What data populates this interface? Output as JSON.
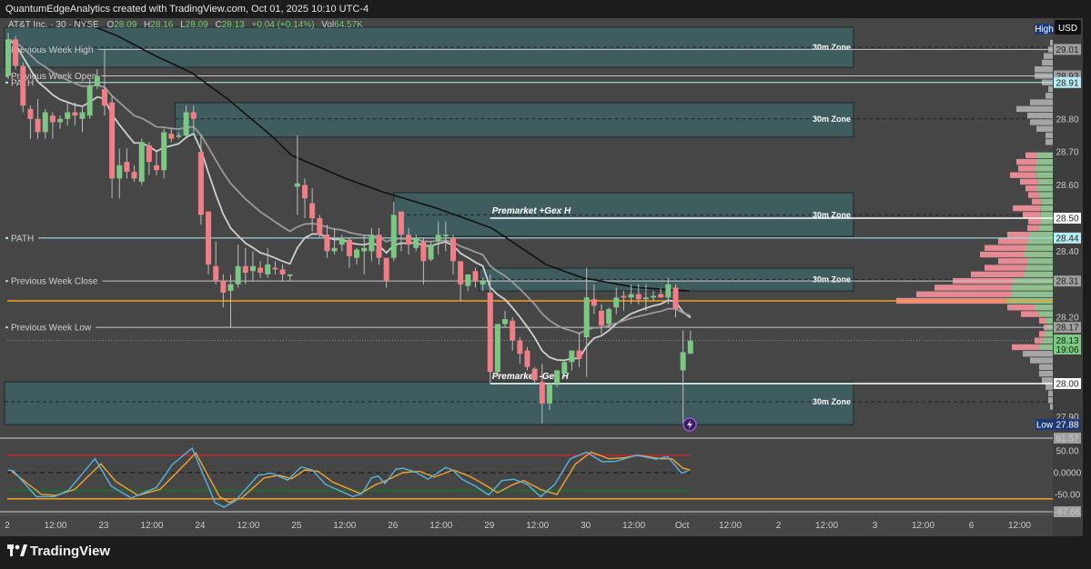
{
  "header": {
    "title": "QuantumEdgeAnalytics created with TradingView.com, Oct 01, 2025 10:10 UTC-4"
  },
  "legend": {
    "symbol": "AT&T Inc. · 30 · NYSE",
    "o_label": "O",
    "o": "28.09",
    "h_label": "H",
    "h": "28.16",
    "l_label": "L",
    "l": "28.09",
    "c_label": "C",
    "c": "28.13",
    "change": "+0.04 (+0.14%)",
    "vol_label": "Vol",
    "vol": "64.57K"
  },
  "axis": {
    "currency": "USD",
    "high_tag": "High",
    "high_value": "29.01",
    "low_tag": "Low",
    "low_value": "27.88",
    "countdown": "19:06"
  },
  "footer": {
    "brand": "TradingView"
  },
  "colors": {
    "up": "#7cc784",
    "down": "#ef7e86",
    "background": "#464646",
    "zone_fill": "#3f5c5e",
    "path": "#b6eef6",
    "orange": "#f5a023",
    "sma": "#111111",
    "ema_fast": "#cfcfcf",
    "ema_slow": "#9a9a9a",
    "osc_k": "#56b4e0",
    "osc_d": "#f2a431"
  },
  "chart_data": {
    "type": "candlestick",
    "title": "AT&T Inc. · 30 · NYSE",
    "interval": "30m",
    "ylim": [
      27.85,
      29.1
    ],
    "price_ticks": [
      "28.80",
      "28.70",
      "28.60",
      "28.40",
      "28.20",
      "27.90"
    ],
    "time_labels": [
      "2",
      "12:00",
      "23",
      "12:00",
      "24",
      "12:00",
      "25",
      "12:00",
      "26",
      "12:00",
      "29",
      "12:00",
      "30",
      "12:00",
      "Oct",
      "12:00",
      "2",
      "12:00",
      "3",
      "12:00",
      "6",
      "12:00"
    ],
    "time_label_bars": [
      0,
      6.5,
      13,
      19.5,
      26,
      32.5,
      39,
      45.5,
      52,
      58.5,
      65,
      71.5,
      78,
      84.5,
      91,
      97.5,
      104,
      110.5,
      117,
      123.5,
      130,
      136.5
    ],
    "candles_ohlc": [
      [
        28.93,
        29.06,
        28.92,
        29.04
      ],
      [
        29.04,
        29.05,
        28.95,
        28.96
      ],
      [
        28.96,
        28.97,
        28.82,
        28.84
      ],
      [
        28.83,
        28.84,
        28.74,
        28.8
      ],
      [
        28.8,
        28.86,
        28.74,
        28.76
      ],
      [
        28.76,
        28.83,
        28.74,
        28.82
      ],
      [
        28.81,
        28.82,
        28.74,
        28.79
      ],
      [
        28.79,
        28.81,
        28.77,
        28.8
      ],
      [
        28.8,
        28.85,
        28.78,
        28.82
      ],
      [
        28.82,
        28.85,
        28.78,
        28.81
      ],
      [
        28.8,
        28.84,
        28.76,
        28.82
      ],
      [
        28.81,
        28.92,
        28.8,
        28.9
      ],
      [
        28.9,
        28.95,
        28.89,
        28.93
      ],
      [
        28.89,
        29.01,
        28.81,
        28.84
      ],
      [
        28.85,
        28.87,
        28.56,
        28.62
      ],
      [
        28.62,
        28.71,
        28.56,
        28.66
      ],
      [
        28.67,
        28.71,
        28.62,
        28.64
      ],
      [
        28.64,
        28.66,
        28.61,
        28.62
      ],
      [
        28.61,
        28.74,
        28.6,
        28.73
      ],
      [
        28.72,
        28.73,
        28.63,
        28.67
      ],
      [
        28.66,
        28.7,
        28.63,
        28.645
      ],
      [
        28.645,
        28.77,
        28.62,
        28.76
      ],
      [
        28.755,
        28.77,
        28.73,
        28.74
      ],
      [
        28.745,
        28.76,
        28.74,
        28.75
      ],
      [
        28.75,
        28.84,
        28.74,
        28.82
      ],
      [
        28.82,
        28.84,
        28.76,
        28.8
      ],
      [
        28.7,
        28.75,
        28.48,
        28.51
      ],
      [
        28.52,
        28.52,
        28.33,
        28.36
      ],
      [
        28.355,
        28.43,
        28.3,
        28.31
      ],
      [
        28.31,
        28.33,
        28.23,
        28.275
      ],
      [
        28.28,
        28.33,
        28.17,
        28.3
      ],
      [
        28.3,
        28.42,
        28.29,
        28.355
      ],
      [
        28.355,
        28.41,
        28.3,
        28.335
      ],
      [
        28.34,
        28.4,
        28.31,
        28.355
      ],
      [
        28.35,
        28.37,
        28.32,
        28.335
      ],
      [
        28.33,
        28.41,
        28.32,
        28.36
      ],
      [
        28.35,
        28.37,
        28.33,
        28.345
      ],
      [
        28.345,
        28.36,
        28.31,
        28.33
      ],
      [
        28.325,
        28.33,
        28.31,
        28.33
      ],
      [
        28.595,
        28.75,
        28.51,
        28.605
      ],
      [
        28.6,
        28.62,
        28.5,
        28.56
      ],
      [
        28.545,
        28.59,
        28.46,
        28.5
      ],
      [
        28.5,
        28.51,
        28.44,
        28.45
      ],
      [
        28.45,
        28.48,
        28.38,
        28.4
      ],
      [
        28.4,
        28.47,
        28.39,
        28.41
      ],
      [
        28.42,
        28.45,
        28.4,
        28.44
      ],
      [
        28.435,
        28.44,
        28.35,
        28.385
      ],
      [
        28.38,
        28.41,
        28.36,
        28.405
      ],
      [
        28.4,
        28.45,
        28.33,
        28.41
      ],
      [
        28.4,
        28.47,
        28.37,
        28.45
      ],
      [
        28.45,
        28.47,
        28.36,
        28.38
      ],
      [
        28.38,
        28.38,
        28.29,
        28.31
      ],
      [
        28.38,
        28.55,
        28.37,
        28.51
      ],
      [
        28.52,
        28.52,
        28.4,
        28.45
      ],
      [
        28.45,
        28.47,
        28.39,
        28.42
      ],
      [
        28.41,
        28.45,
        28.4,
        28.44
      ],
      [
        28.43,
        28.44,
        28.3,
        28.37
      ],
      [
        28.375,
        28.43,
        28.37,
        28.42
      ],
      [
        28.43,
        28.49,
        28.39,
        28.45
      ],
      [
        28.445,
        28.49,
        28.4,
        28.45
      ],
      [
        28.44,
        28.45,
        28.33,
        28.37
      ],
      [
        28.37,
        28.37,
        28.25,
        28.3
      ],
      [
        28.295,
        28.33,
        28.28,
        28.33
      ],
      [
        28.34,
        28.35,
        28.29,
        28.31
      ],
      [
        28.3,
        28.32,
        28.28,
        28.31
      ],
      [
        28.275,
        28.33,
        28.0,
        28.035
      ],
      [
        28.035,
        28.18,
        28.03,
        28.18
      ],
      [
        28.18,
        28.22,
        28.17,
        28.195
      ],
      [
        28.19,
        28.2,
        28.1,
        28.13
      ],
      [
        28.13,
        28.14,
        28.06,
        28.09
      ],
      [
        28.1,
        28.11,
        28.04,
        28.05
      ],
      [
        28.045,
        28.05,
        28.0,
        28.01
      ],
      [
        28.005,
        28.06,
        27.88,
        27.94
      ],
      [
        27.94,
        28.0,
        27.92,
        28.0
      ],
      [
        28.0,
        28.04,
        27.99,
        28.04
      ],
      [
        28.03,
        28.07,
        28.02,
        28.065
      ],
      [
        28.065,
        28.1,
        28.04,
        28.1
      ],
      [
        28.1,
        28.155,
        28.05,
        28.075
      ],
      [
        28.14,
        28.35,
        28.02,
        28.26
      ],
      [
        28.255,
        28.3,
        28.21,
        28.235
      ],
      [
        28.22,
        28.24,
        28.15,
        28.175
      ],
      [
        28.18,
        28.23,
        28.17,
        28.225
      ],
      [
        28.23,
        28.29,
        28.21,
        28.26
      ],
      [
        28.265,
        28.28,
        28.22,
        28.26
      ],
      [
        28.26,
        28.3,
        28.24,
        28.27
      ],
      [
        28.27,
        28.3,
        28.24,
        28.255
      ],
      [
        28.255,
        28.3,
        28.22,
        28.26
      ],
      [
        28.26,
        28.28,
        28.25,
        28.265
      ],
      [
        28.27,
        28.29,
        28.26,
        28.26
      ],
      [
        28.26,
        28.32,
        28.24,
        28.3
      ],
      [
        28.29,
        28.3,
        28.2,
        28.225
      ],
      [
        28.04,
        28.16,
        27.88,
        28.095
      ],
      [
        28.09,
        28.16,
        28.09,
        28.13
      ]
    ],
    "ema_periods": [
      9,
      20
    ],
    "sma_line": [
      [
        9.3,
        29.1
      ],
      [
        14.8,
        29.05
      ],
      [
        19.9,
        28.99
      ],
      [
        24.7,
        28.94
      ],
      [
        29.6,
        28.86
      ],
      [
        35.7,
        28.745
      ],
      [
        38.2,
        28.69
      ],
      [
        45.5,
        28.62
      ],
      [
        50.4,
        28.58
      ],
      [
        57.8,
        28.53
      ],
      [
        65.2,
        28.47
      ],
      [
        72.5,
        28.36
      ],
      [
        77.4,
        28.32
      ],
      [
        84.8,
        28.29
      ],
      [
        91.9,
        28.28
      ]
    ],
    "zones": [
      {
        "label": "30m Zone",
        "top": 29.077,
        "bottom": 28.956,
        "mid": 29.016,
        "start_bar": 0,
        "end_bar": 114
      },
      {
        "label": "30m Zone",
        "top": 28.849,
        "bottom": 28.745,
        "mid": 28.8,
        "start_bar": 23,
        "end_bar": 114
      },
      {
        "label": "30m Zone",
        "top": 28.577,
        "bottom": 28.445,
        "mid": 28.51,
        "start_bar": 52.5,
        "end_bar": 114
      },
      {
        "label": "30m Zone",
        "top": 28.349,
        "bottom": 28.28,
        "mid": 28.315,
        "start_bar": 64,
        "end_bar": 114
      },
      {
        "label": "30m Zone",
        "top": 28.005,
        "bottom": 27.876,
        "mid": 27.945,
        "start_bar": 0,
        "end_bar": 114
      }
    ],
    "levels": [
      {
        "name": "Previous Week High",
        "price": 29.01,
        "axis_label": "29.01",
        "kind": "pw"
      },
      {
        "name": "Previous Week Open",
        "price": 28.93,
        "axis_label": "28.93",
        "kind": "pw"
      },
      {
        "name": "PATH",
        "price": 28.91,
        "axis_label": "28.91",
        "kind": "path"
      },
      {
        "name": "Premarket +Gex H",
        "price": 28.5,
        "axis_label": "28.50",
        "kind": "gex",
        "start_bar": 65
      },
      {
        "name": "PATH",
        "price": 28.44,
        "axis_label": "28.44",
        "kind": "path"
      },
      {
        "name": "Previous Week Close",
        "price": 28.31,
        "axis_label": "28.31",
        "kind": "pw"
      },
      {
        "name": "",
        "price": 28.25,
        "axis_label": "",
        "kind": "orange"
      },
      {
        "name": "Previous Week Low",
        "price": 28.17,
        "axis_label": "28.17",
        "kind": "pw"
      },
      {
        "name": "Premarket -Gex H",
        "price": 28.0,
        "axis_label": "28.00",
        "kind": "gex",
        "start_bar": 65
      },
      {
        "name": "",
        "price": 28.13,
        "axis_label": "28.13",
        "kind": "last"
      }
    ],
    "volume_profile": [
      [
        29.03,
        3,
        0
      ],
      [
        29.01,
        5,
        0
      ],
      [
        28.99,
        10,
        0
      ],
      [
        28.97,
        12,
        0
      ],
      [
        28.95,
        20,
        0
      ],
      [
        28.93,
        20,
        0
      ],
      [
        28.91,
        12,
        0
      ],
      [
        28.89,
        5,
        0
      ],
      [
        28.87,
        8,
        0
      ],
      [
        28.85,
        25,
        0
      ],
      [
        28.83,
        40,
        0
      ],
      [
        28.81,
        28,
        0
      ],
      [
        28.79,
        25,
        0
      ],
      [
        28.77,
        18,
        0
      ],
      [
        28.75,
        8,
        0
      ],
      [
        28.73,
        8,
        0
      ],
      [
        28.69,
        30,
        0.6
      ],
      [
        28.67,
        40,
        0.45
      ],
      [
        28.65,
        38,
        0.5
      ],
      [
        28.63,
        47,
        0.4
      ],
      [
        28.61,
        36,
        0.45
      ],
      [
        28.59,
        30,
        0.6
      ],
      [
        28.57,
        27,
        0.55
      ],
      [
        28.55,
        23,
        0.55
      ],
      [
        28.53,
        44,
        0.3
      ],
      [
        28.51,
        33,
        0.4
      ],
      [
        28.49,
        27,
        0.5
      ],
      [
        28.47,
        28,
        0.55
      ],
      [
        28.45,
        50,
        0.5
      ],
      [
        28.43,
        60,
        0.45
      ],
      [
        28.41,
        75,
        0.4
      ],
      [
        28.39,
        80,
        0.4
      ],
      [
        28.37,
        60,
        0.45
      ],
      [
        28.35,
        75,
        0.4
      ],
      [
        28.33,
        90,
        0.35
      ],
      [
        28.31,
        110,
        0.4
      ],
      [
        28.29,
        130,
        0.35
      ],
      [
        28.27,
        150,
        0.3
      ],
      [
        28.25,
        172,
        0.3
      ],
      [
        28.23,
        50,
        0.4
      ],
      [
        28.21,
        35,
        0.45
      ],
      [
        28.19,
        15,
        0.5
      ],
      [
        28.17,
        10,
        0.5
      ],
      [
        28.15,
        15,
        0.6
      ],
      [
        28.13,
        20,
        0.55
      ],
      [
        28.11,
        45,
        0.35
      ],
      [
        28.09,
        33,
        0
      ],
      [
        28.07,
        25,
        0
      ],
      [
        28.05,
        15,
        0
      ],
      [
        28.03,
        15,
        0
      ],
      [
        28.01,
        12,
        0
      ],
      [
        27.99,
        8,
        0
      ],
      [
        27.97,
        5,
        0
      ],
      [
        27.95,
        5,
        0
      ],
      [
        27.93,
        3,
        0
      ]
    ],
    "oscillator": {
      "ylim": [
        -87.66,
        81.57
      ],
      "axis_labels": [
        "81.57",
        "50.00",
        "0.0000",
        "-50.00",
        "-87.66"
      ],
      "axis_values": [
        81.57,
        50,
        0,
        -50,
        -87.66
      ],
      "levels": {
        "upper": 40,
        "middle": 0,
        "lower_green": -41,
        "lower_orange": -60
      },
      "k_line": [
        [
          0,
          6
        ],
        [
          0.7,
          4
        ],
        [
          3.8,
          -55
        ],
        [
          6.2,
          -55
        ],
        [
          8.1,
          -41
        ],
        [
          11.7,
          32
        ],
        [
          13.9,
          -31
        ],
        [
          16.6,
          -58
        ],
        [
          20,
          -34
        ],
        [
          22.1,
          18
        ],
        [
          24.8,
          56
        ],
        [
          27.9,
          -69
        ],
        [
          29.1,
          -79
        ],
        [
          30.6,
          -65
        ],
        [
          33.7,
          -6
        ],
        [
          35.5,
          -1
        ],
        [
          37.7,
          -17
        ],
        [
          39.5,
          13
        ],
        [
          41,
          6
        ],
        [
          42.8,
          -27
        ],
        [
          46.5,
          -55
        ],
        [
          47.7,
          -48
        ],
        [
          49,
          -12
        ],
        [
          49.9,
          -8
        ],
        [
          50.8,
          -25
        ],
        [
          52.3,
          8
        ],
        [
          53.2,
          10
        ],
        [
          55,
          1
        ],
        [
          56.6,
          -15
        ],
        [
          59,
          12
        ],
        [
          59.9,
          6
        ],
        [
          61.2,
          -15
        ],
        [
          63,
          -31
        ],
        [
          64.8,
          -51
        ],
        [
          66.6,
          -18
        ],
        [
          68.2,
          -15
        ],
        [
          70,
          -27
        ],
        [
          71.8,
          -55
        ],
        [
          73.7,
          -27
        ],
        [
          75.8,
          32
        ],
        [
          78,
          47
        ],
        [
          80.1,
          25
        ],
        [
          81.9,
          26
        ],
        [
          84.7,
          40
        ],
        [
          87.4,
          31
        ],
        [
          88.9,
          37
        ],
        [
          90.8,
          -1
        ],
        [
          91.7,
          4
        ]
      ],
      "d_line": [
        [
          0.5,
          3
        ],
        [
          4.5,
          -50
        ],
        [
          6.5,
          -52
        ],
        [
          9,
          -38
        ],
        [
          12.5,
          20
        ],
        [
          14.5,
          -20
        ],
        [
          17.5,
          -52
        ],
        [
          20.5,
          -38
        ],
        [
          23,
          5
        ],
        [
          25.3,
          45
        ],
        [
          28.5,
          -55
        ],
        [
          29.8,
          -68
        ],
        [
          31.5,
          -58
        ],
        [
          34.5,
          -12
        ],
        [
          36.5,
          -6
        ],
        [
          38.2,
          -14
        ],
        [
          40,
          6
        ],
        [
          41.8,
          3
        ],
        [
          43.8,
          -22
        ],
        [
          47.5,
          -48
        ],
        [
          49.5,
          -28
        ],
        [
          51,
          -18
        ],
        [
          53.2,
          0
        ],
        [
          55.5,
          3
        ],
        [
          57.5,
          -10
        ],
        [
          60,
          6
        ],
        [
          62.2,
          -8
        ],
        [
          64,
          -25
        ],
        [
          66,
          -46
        ],
        [
          68,
          -28
        ],
        [
          69.5,
          -18
        ],
        [
          72,
          -40
        ],
        [
          74,
          -50
        ],
        [
          76.5,
          20
        ],
        [
          78.6,
          47
        ],
        [
          81,
          32
        ],
        [
          83,
          34
        ],
        [
          85,
          40
        ],
        [
          88,
          32
        ],
        [
          89.5,
          32
        ],
        [
          91,
          10
        ],
        [
          92,
          6
        ]
      ]
    }
  }
}
